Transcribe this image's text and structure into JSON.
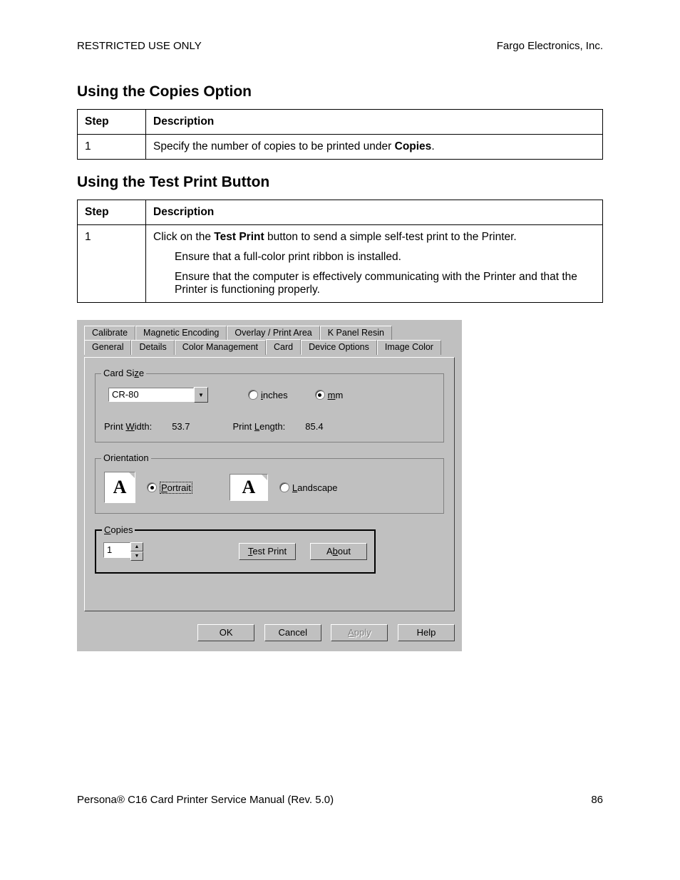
{
  "header": {
    "left": "RESTRICTED USE ONLY",
    "right": "Fargo Electronics, Inc."
  },
  "section1": {
    "title": "Using the Copies Option",
    "th_step": "Step",
    "th_desc": "Description",
    "rows": [
      {
        "step": "1",
        "desc_pre": "Specify the number of copies to be printed under ",
        "desc_bold": "Copies",
        "desc_post": "."
      }
    ]
  },
  "section2": {
    "title": "Using the Test Print Button",
    "th_step": "Step",
    "th_desc": "Description",
    "step": "1",
    "desc_pre": "Click on the ",
    "desc_bold": "Test Print",
    "desc_post": " button to send a simple self-test print to the Printer.",
    "sub1": "Ensure that a full-color print ribbon is installed.",
    "sub2": "Ensure that the computer is effectively communicating with the Printer and that the Printer is functioning properly."
  },
  "dialog": {
    "tabs_top": [
      "Calibrate",
      "Magnetic Encoding",
      "Overlay / Print Area",
      "K Panel Resin"
    ],
    "tabs_bottom": [
      "General",
      "Details",
      "Color Management",
      "Card",
      "Device Options",
      "Image Color"
    ],
    "active_tab": "Card",
    "card_size": {
      "legend": "Card Size",
      "combo": "CR-80",
      "radio_inches": "inches",
      "radio_mm": "mm",
      "pw_label": "Print Width:",
      "pw_val": "53.7",
      "pl_label": "Print Length:",
      "pl_val": "85.4"
    },
    "orientation": {
      "legend": "Orientation",
      "portrait": "Portrait",
      "landscape": "Landscape"
    },
    "copies": {
      "legend": "Copies",
      "value": "1",
      "test_print": "Test Print",
      "about": "About"
    },
    "buttons": {
      "ok": "OK",
      "cancel": "Cancel",
      "apply": "Apply",
      "help": "Help"
    }
  },
  "footer": {
    "left": "Persona® C16 Card Printer Service Manual (Rev. 5.0)",
    "right": "86"
  }
}
